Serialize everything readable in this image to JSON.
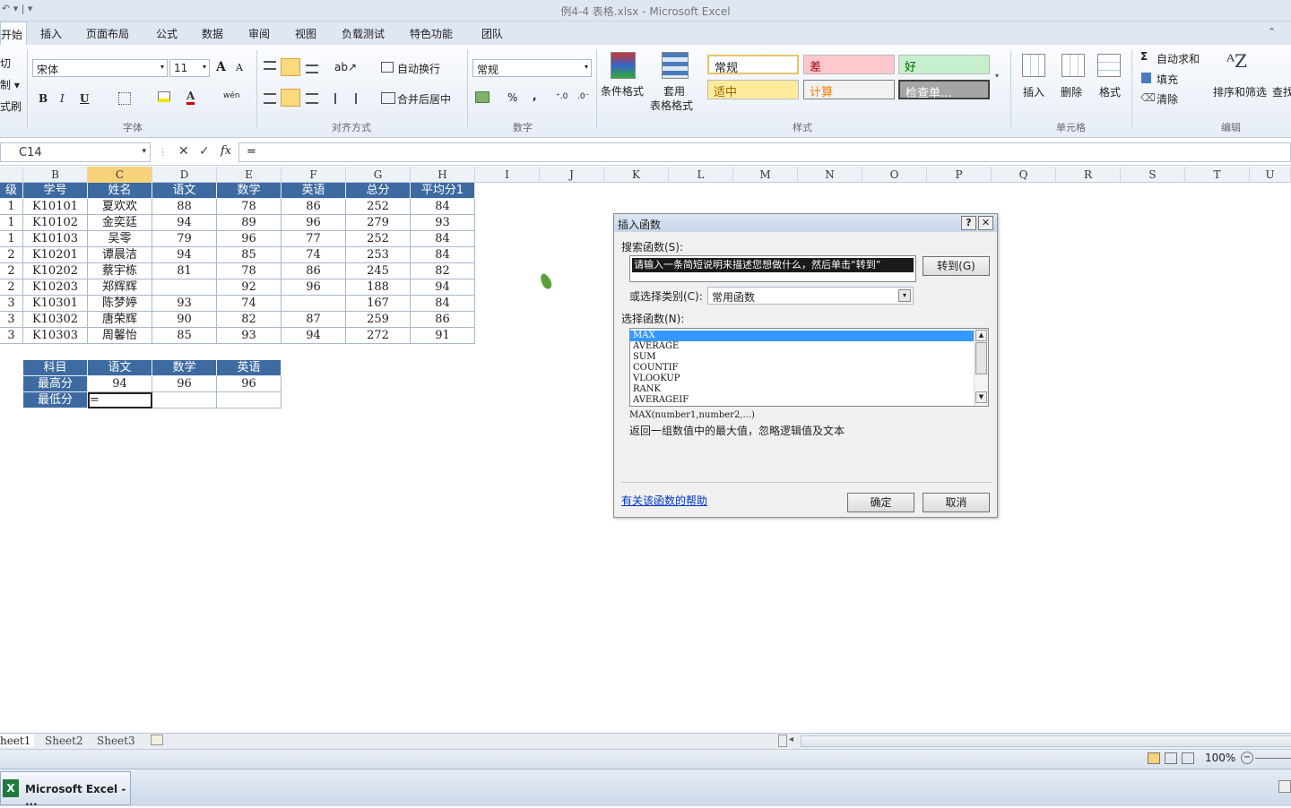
{
  "window": {
    "title": "例4-4 表格.xlsx - Microsoft Excel"
  },
  "ribbon": {
    "tabs": [
      "开始",
      "插入",
      "页面布局",
      "公式",
      "数据",
      "审阅",
      "视图",
      "负载测试",
      "特色功能",
      "团队"
    ],
    "clipboard": {
      "cut": "切",
      "copy": "制 ▾",
      "painter": "式刷"
    },
    "font": {
      "name": "宋体",
      "size": "11",
      "group": "字体",
      "bold": "B",
      "italic": "I",
      "underline": "U",
      "grow": "A",
      "shrink": "A",
      "color_a": "A",
      "wen": "wén"
    },
    "align": {
      "wrap": "自动换行",
      "merge": "合并后居中",
      "group": "对齐方式"
    },
    "number": {
      "format": "常规",
      "percent": "%",
      "comma": ",",
      "group": "数字"
    },
    "styles": {
      "cond": "条件格式",
      "table": [
        "套用",
        "表格格式"
      ],
      "items": [
        "常规",
        "差",
        "好",
        "适中",
        "计算",
        "检查单..."
      ],
      "group": "样式"
    },
    "cells": {
      "insert": "插入",
      "delete": "删除",
      "format": "格式",
      "group": "单元格"
    },
    "edit": {
      "autosum": "自动求和",
      "fill": "填充",
      "clear": "清除",
      "sort": "排序和筛选",
      "find": "查找",
      "group": "编辑"
    }
  },
  "formula_bar": {
    "namebox": "C14",
    "formula": "=",
    "fx": "fx"
  },
  "columns": [
    "B",
    "C",
    "D",
    "E",
    "F",
    "G",
    "H",
    "I",
    "J",
    "K",
    "L",
    "M",
    "N",
    "O",
    "P",
    "Q",
    "R",
    "S",
    "T",
    "U"
  ],
  "table": {
    "headers": [
      "学号",
      "姓名",
      "语文",
      "数学",
      "英语",
      "总分",
      "平均分1"
    ],
    "rows": [
      {
        "a": "1",
        "cells": [
          "K10101",
          "夏欢欢",
          "88",
          "78",
          "86",
          "252",
          "84"
        ]
      },
      {
        "a": "1",
        "cells": [
          "K10102",
          "金奕廷",
          "94",
          "89",
          "96",
          "279",
          "93"
        ]
      },
      {
        "a": "1",
        "cells": [
          "K10103",
          "吴零",
          "79",
          "96",
          "77",
          "252",
          "84"
        ]
      },
      {
        "a": "2",
        "cells": [
          "K10201",
          "谭晨洁",
          "94",
          "85",
          "74",
          "253",
          "84"
        ]
      },
      {
        "a": "2",
        "cells": [
          "K10202",
          "蔡宇栋",
          "81",
          "78",
          "86",
          "245",
          "82"
        ]
      },
      {
        "a": "2",
        "cells": [
          "K10203",
          "郑辉辉",
          "",
          "92",
          "96",
          "188",
          "94"
        ]
      },
      {
        "a": "3",
        "cells": [
          "K10301",
          "陈梦婷",
          "93",
          "74",
          "",
          "167",
          "84"
        ]
      },
      {
        "a": "3",
        "cells": [
          "K10302",
          "唐荣辉",
          "90",
          "82",
          "87",
          "259",
          "86"
        ]
      },
      {
        "a": "3",
        "cells": [
          "K10303",
          "周馨怡",
          "85",
          "93",
          "94",
          "272",
          "91"
        ]
      }
    ],
    "a_header": "级"
  },
  "summary": {
    "headers": [
      "科目",
      "语文",
      "数学",
      "英语"
    ],
    "rows": [
      [
        "最高分",
        "94",
        "96",
        "96"
      ],
      [
        "最低分",
        "=",
        "",
        ""
      ]
    ]
  },
  "dialog": {
    "title": "插入函数",
    "help_btn": "?",
    "close_btn": "✕",
    "search_label": "搜索函数(S):",
    "search_value": "请输入一条简短说明来描述您想做什么，然后单击“转到”",
    "go": "转到(G)",
    "category_label": "或选择类别(C):",
    "category": "常用函数",
    "select_label": "选择函数(N):",
    "functions": [
      "MAX",
      "AVERAGE",
      "SUM",
      "COUNTIF",
      "VLOOKUP",
      "RANK",
      "AVERAGEIF"
    ],
    "signature": "MAX(number1,number2,...)",
    "description": "返回一组数值中的最大值，忽略逻辑值及文本",
    "help_link": "有关该函数的帮助",
    "ok": "确定",
    "cancel": "取消"
  },
  "sheets": [
    "heet1",
    "Sheet2",
    "Sheet3"
  ],
  "status": {
    "zoom": "100%"
  },
  "taskbar": {
    "app": "Microsoft Excel - ..."
  }
}
